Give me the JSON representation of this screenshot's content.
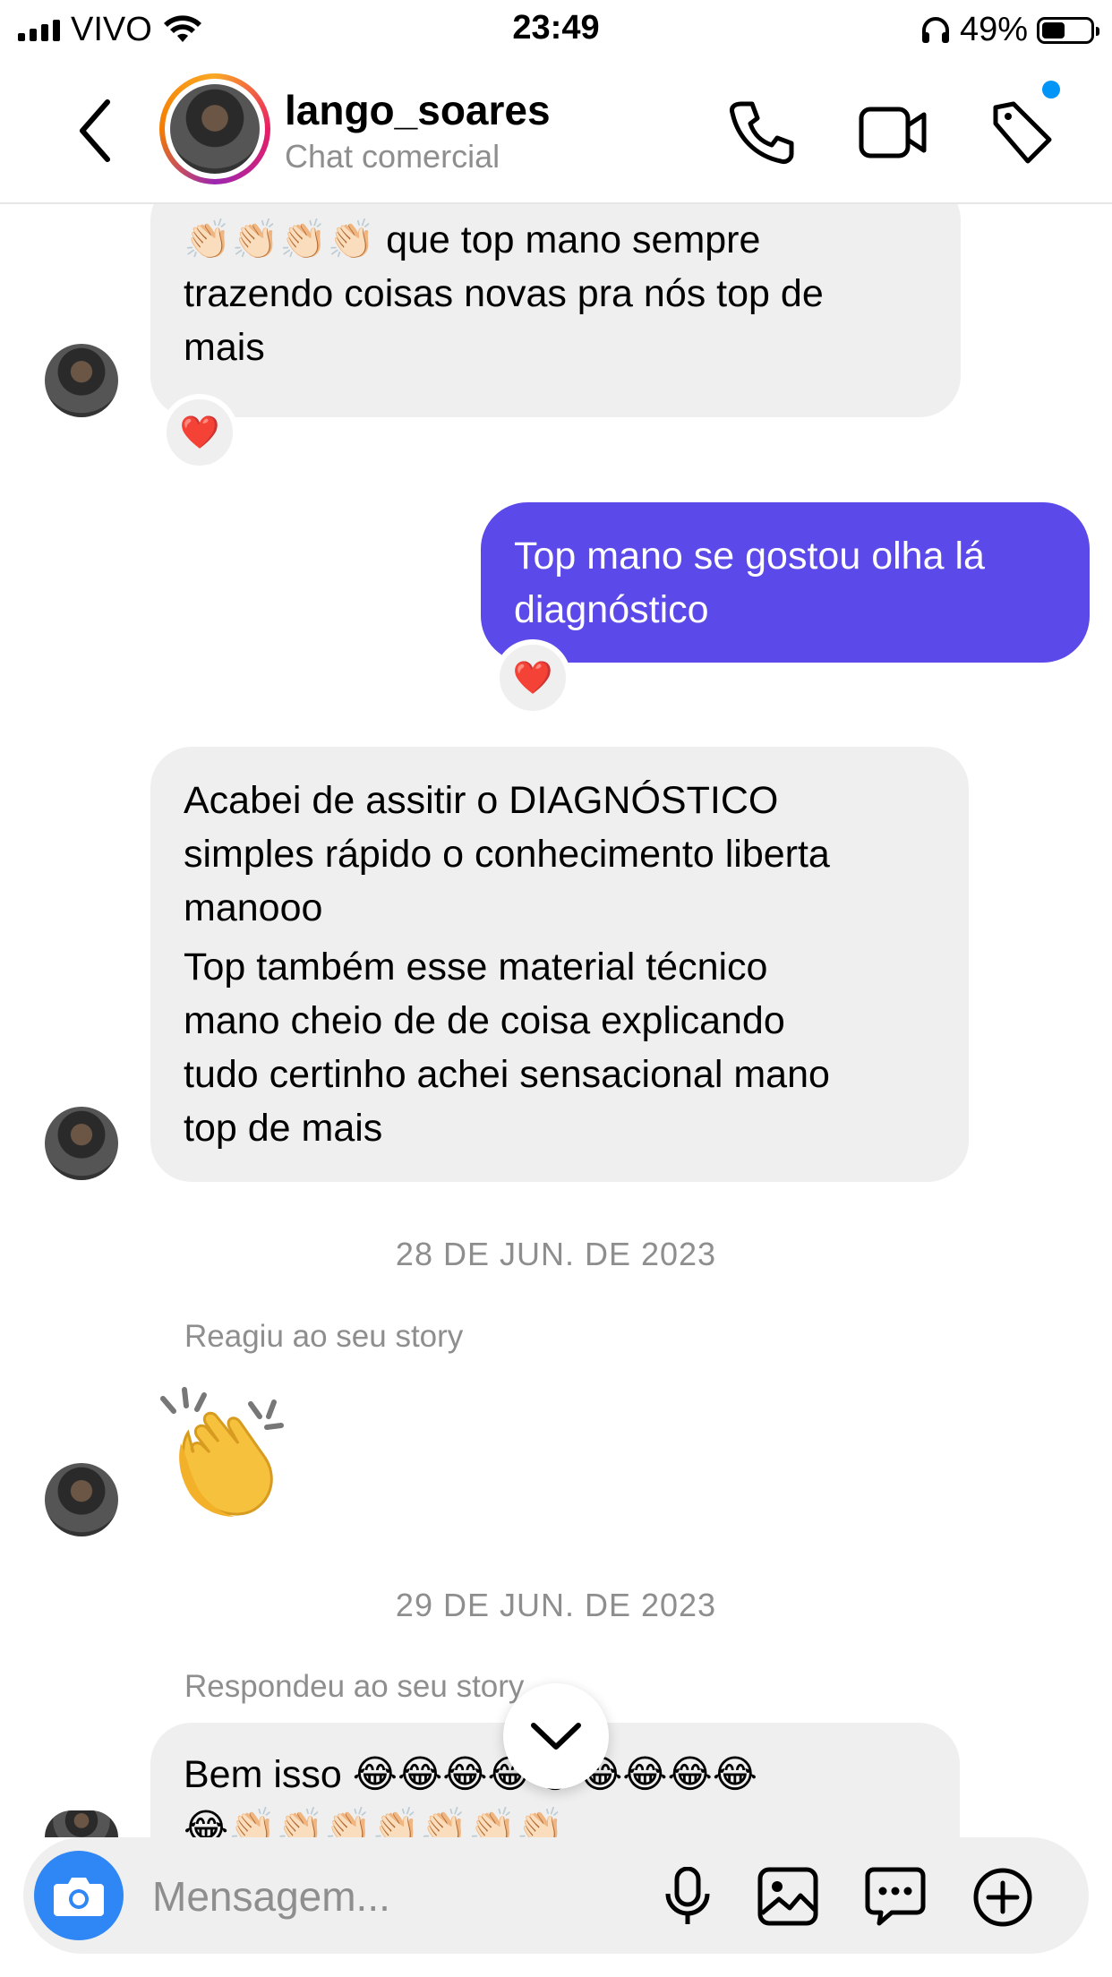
{
  "status_bar": {
    "carrier": "VIVO",
    "time": "23:49",
    "battery": "49%",
    "battery_level": 0.49
  },
  "header": {
    "username": "lango_soares",
    "subtitle": "Chat comercial"
  },
  "messages": {
    "m1": {
      "text": "tena nesses carros desses anos 👏🏻\n👏🏻👏🏻👏🏻👏🏻 que top mano sempre\ntrazendo coisas novas pra nós top de\nmais",
      "reaction": "❤️"
    },
    "m2": {
      "text": "Top mano se gostou olha lá\ndiagnóstico",
      "reaction": "❤️"
    },
    "m3": {
      "text": "Acabei de assitir o DIAGNÓSTICO\nsimples rápido o conhecimento liberta\nmanooo",
      "text2": "Top também esse material técnico\nmano cheio de de coisa explicando\ntudo certinho achei sensacional mano\ntop de mais"
    },
    "date1": "28 DE JUN. DE 2023",
    "note1": "Reagiu ao seu story",
    "date2": "29 DE JUN. DE 2023",
    "note2": "Respondeu ao seu story",
    "m4": {
      "text": "Bem isso 😂😂😂😂😂😂😂😂😂\n😂👏🏻👏🏻👏🏻👏🏻👏🏻👏🏻👏🏻"
    }
  },
  "composer": {
    "placeholder": "Mensagem..."
  },
  "colors": {
    "accent": "#5b49ea",
    "camera": "#2f86f5",
    "notification_dot": "#0095f6"
  }
}
